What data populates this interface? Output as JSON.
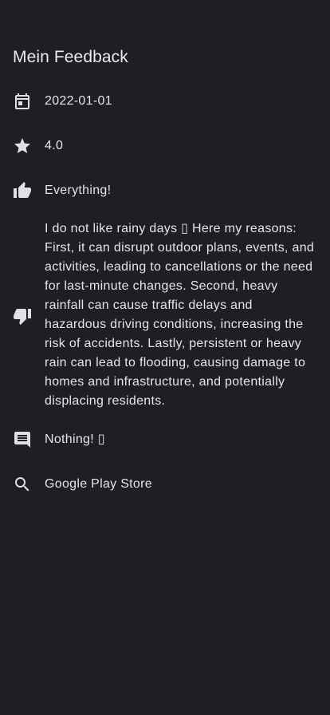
{
  "header": {
    "title": "Mein Feedback"
  },
  "feedback": {
    "date": "2022-01-01",
    "rating": "4.0",
    "likes": "Everything!",
    "dislikes": "I do not like rainy days ▯ Here my reasons: First, it can disrupt outdoor plans, events, and activities, leading to cancellations or the need for last-minute changes. Second, heavy rainfall can cause traffic delays and hazardous driving conditions, increasing the risk of accidents. Lastly, persistent or heavy rain can lead to flooding, causing damage to homes and infrastructure, and potentially displacing residents.",
    "comment": "Nothing! ▯",
    "source": "Google Play Store"
  },
  "icons": {
    "date": "calendar-icon",
    "rating": "star-icon",
    "likes": "thumb-up-icon",
    "dislikes": "thumb-down-icon",
    "comment": "comment-icon",
    "source": "search-icon"
  },
  "colors": {
    "background": "#1f1e24",
    "text": "#e7e4ea",
    "icon": "#e2dfe6"
  }
}
